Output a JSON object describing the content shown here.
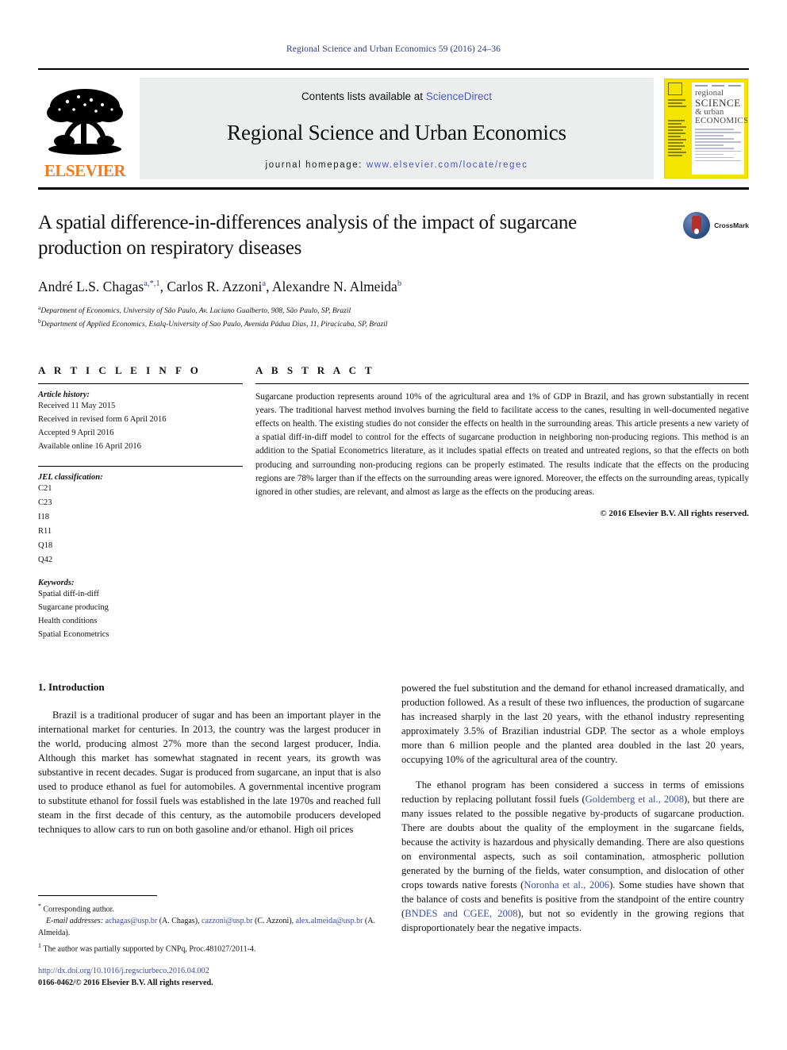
{
  "running_head": "Regional Science and Urban Economics 59 (2016) 24–36",
  "header": {
    "contents_prefix": "Contents lists available at ",
    "sciencedirect": "ScienceDirect",
    "journal_title": "Regional Science and Urban Economics",
    "homepage_label": "journal homepage:",
    "homepage_url": "www.elsevier.com/locate/regec",
    "publisher": "ELSEVIER",
    "cover": {
      "line1": "regional",
      "line2": "SCIENCE",
      "line3": "& urban",
      "line4": "ECONOMICS"
    }
  },
  "article": {
    "title": "A spatial difference-in-differences analysis of the impact of sugarcane production on respiratory diseases",
    "crossmark_label": "CrossMark",
    "authors": [
      {
        "name": "André L.S. Chagas",
        "sup": "a,*,1",
        "sep": ", "
      },
      {
        "name": "Carlos R. Azzoni",
        "sup": "a",
        "sep": ", "
      },
      {
        "name": "Alexandre N. Almeida",
        "sup": "b",
        "sep": ""
      }
    ],
    "affiliations": [
      {
        "mark": "a",
        "text": "Department of Economics, University of São Paulo, Av. Luciano Gualberto, 908, São Paulo, SP, Brazil"
      },
      {
        "mark": "b",
        "text": "Department of Applied Economics, Esalq-University of Sao Paulo, Avenida Pádua Dias, 11, Piracicaba, SP, Brazil"
      }
    ]
  },
  "info": {
    "heading": "A R T I C L E   I N F O",
    "history_label": "Article history:",
    "history": [
      "Received 11 May 2015",
      "Received in revised form 6 April 2016",
      "Accepted 9 April 2016",
      "Available online 16 April 2016"
    ],
    "jel_label": "JEL classification:",
    "jel": [
      "C21",
      "C23",
      "I18",
      "R11",
      "Q18",
      "Q42"
    ],
    "keywords_label": "Keywords:",
    "keywords": [
      "Spatial diff-in-diff",
      "Sugarcane producing",
      "Health conditions",
      "Spatial Econometrics"
    ]
  },
  "abstract": {
    "heading": "A B S T R A C T",
    "text": "Sugarcane production represents around 10% of the agricultural area and 1% of GDP in Brazil, and has grown substantially in recent years. The traditional harvest method involves burning the field to facilitate access to the canes, resulting in well-documented negative effects on health. The existing studies do not consider the effects on health in the surrounding areas. This article presents a new variety of a spatial diff-in-diff model to control for the effects of sugarcane production in neighboring non-producing regions. This method is an addition to the Spatial Econometrics literature, as it includes spatial effects on treated and untreated regions, so that the effects on both producing and surrounding non-producing regions can be properly estimated. The results indicate that the effects on the producing regions are 78% larger than if the effects on the surrounding areas were ignored. Moreover, the effects on the surrounding areas, typically ignored in other studies, are relevant, and almost as large as the effects on the producing areas.",
    "copyright": "© 2016 Elsevier B.V. All rights reserved."
  },
  "body": {
    "section_heading": "1. Introduction",
    "left_paragraph": "Brazil is a traditional producer of sugar and has been an important player in the international market for centuries. In 2013, the country was the largest producer in the world, producing almost 27% more than the second largest producer, India. Although this market has somewhat stagnated in recent years, its growth was substantive in recent decades. Sugar is produced from sugarcane, an input that is also used to produce ethanol as fuel for automobiles. A governmental incentive program to substitute ethanol for fossil fuels was established in the late 1970s and reached full steam in the first decade of this century, as the automobile producers developed techniques to allow cars to run on both gasoline and/or ethanol. High oil prices",
    "right_paragraph_1": "powered the fuel substitution and the demand for ethanol increased dramatically, and production followed. As a result of these two influences, the production of sugarcane has increased sharply in the last 20 years, with the ethanol industry representing approximately 3.5% of Brazilian industrial GDP. The sector as a whole employs more than 6 million people and the planted area doubled in the last 20 years, occupying 10% of the agricultural area of the country.",
    "right_paragraph_2_part1": "The ethanol program has been considered a success in terms of emissions reduction by replacing pollutant fossil fuels (",
    "citation_1": "Goldemberg et al., 2008",
    "right_paragraph_2_part2": "), but there are many issues related to the possible negative by-products of sugarcane production. There are doubts about the quality of the employment in the sugarcane fields, because the activity is hazardous and physically demanding. There are also questions on environmental aspects, such as soil contamination, atmospheric pollution generated by the burning of the fields, water consumption, and dislocation of other crops towards native forests (",
    "citation_2": "Noronha et al., 2006",
    "right_paragraph_2_part3": "). Some studies have shown that the balance of costs and benefits is positive from the standpoint of the entire country (",
    "citation_3": "BNDES and CGEE, 2008",
    "right_paragraph_2_part4": "), but not so evidently in the growing regions that disproportionately bear the negative impacts."
  },
  "footnotes": {
    "corresponding": "Corresponding author.",
    "email_label": "E-mail addresses:",
    "emails": [
      {
        "address": "achagas@usp.br",
        "owner": " (A. Chagas), "
      },
      {
        "address": "cazzoni@usp.br",
        "owner": " (C. Azzoni), "
      },
      {
        "address": "alex.almeida@usp.br",
        "owner": " (A. Almeida)."
      }
    ],
    "note_1_mark": "1",
    "note_1": "The author was partially supported by CNPq, Proc.481027/2011-4."
  },
  "footer": {
    "doi": "http://dx.doi.org/10.1016/j.regsciurbeco.2016.04.002",
    "issn": "0166-0462/© 2016 Elsevier B.V. All rights reserved."
  },
  "colors": {
    "link": "#3b4ba8",
    "runhead": "#2f3b8c",
    "elsevier_orange": "#F47B20",
    "cover_yellow": "#F5E400",
    "header_band": "#eceded"
  }
}
